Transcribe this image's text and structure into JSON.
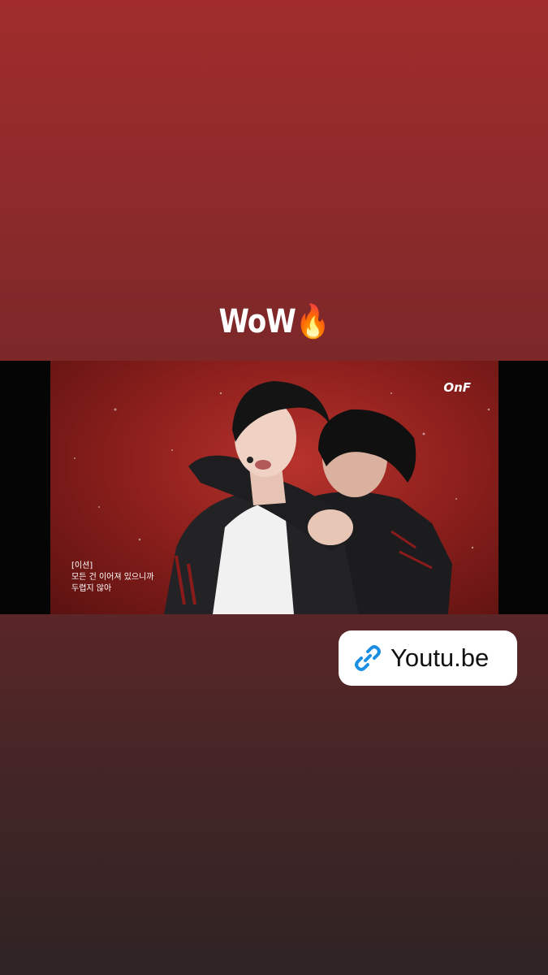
{
  "story": {
    "caption": "WoW🔥"
  },
  "video": {
    "channel_logo": "OnF",
    "subtitle_line1": "[이션]",
    "subtitle_line2": "모든 건 이어져 있으니까",
    "subtitle_line3": "두렵지 않아"
  },
  "link_sticker": {
    "label": "Youtu.be",
    "icon": "link-icon",
    "icon_color": "#1a8fe3"
  },
  "colors": {
    "background_top": "#a02c2c",
    "background_bottom": "#2f2424"
  }
}
